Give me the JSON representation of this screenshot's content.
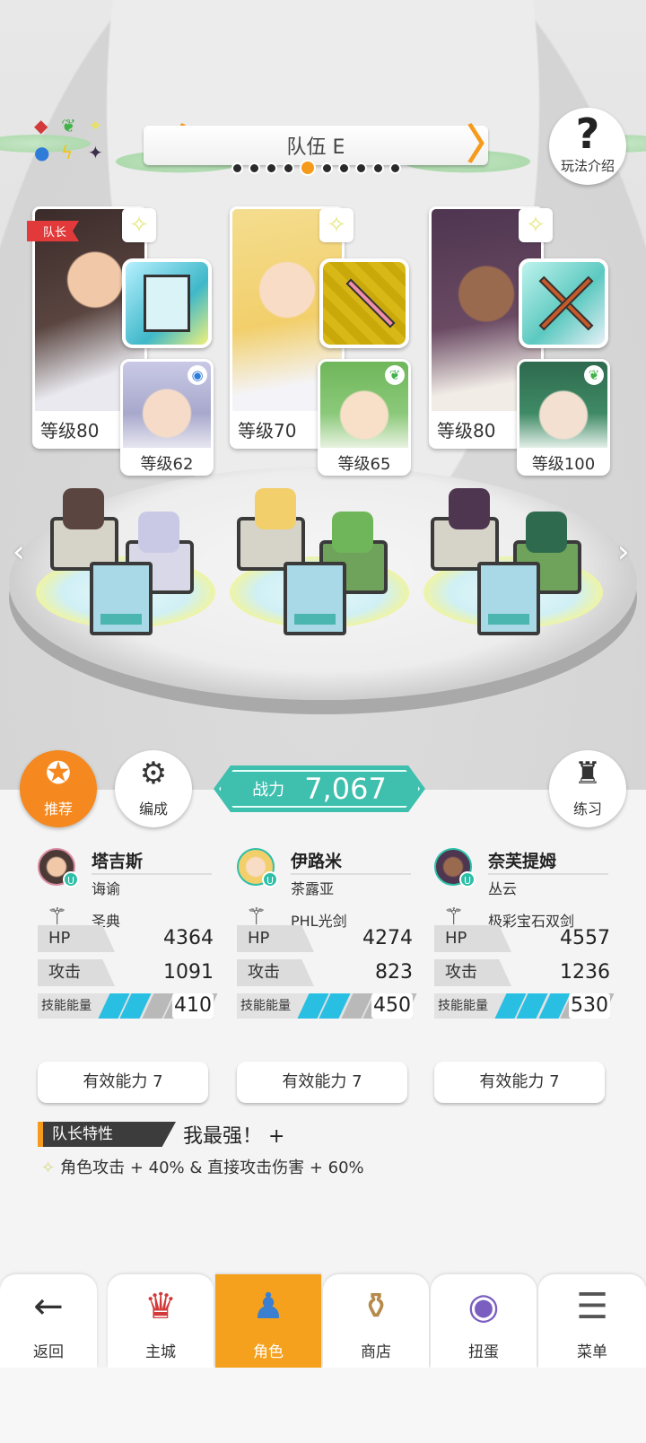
{
  "team": {
    "name": "队伍 E",
    "help_label": "玩法介绍",
    "page_count": 10,
    "active_page": 5
  },
  "characters": [
    {
      "leader_tag": "队长",
      "level": "等级80",
      "support_level": "等级62",
      "support_badge": "◉",
      "name": "塔吉斯",
      "subtitle": "诲谕",
      "weapon": "圣典",
      "hp_label": "HP",
      "hp": "4364",
      "atk_label": "攻击",
      "atk": "1091",
      "energy_label": "技能能量",
      "energy": "410",
      "energy_fill": 0.41,
      "ability": "有效能力 7",
      "portrait_color": "#4b3a36",
      "equip_color": "#3fb8c9"
    },
    {
      "leader_tag": "",
      "level": "等级70",
      "support_level": "等级65",
      "support_badge": "❦",
      "name": "伊路米",
      "subtitle": "茶露亚",
      "weapon": "PHL光剑",
      "hp_label": "HP",
      "hp": "4274",
      "atk_label": "攻击",
      "atk": "823",
      "energy_label": "技能能量",
      "energy": "450",
      "energy_fill": 0.45,
      "ability": "有效能力 7",
      "portrait_color": "#f1d58a",
      "equip_color": "#d8b817"
    },
    {
      "leader_tag": "",
      "level": "等级80",
      "support_level": "等级100",
      "support_badge": "❦",
      "name": "奈芙提姆",
      "subtitle": "丛云",
      "weapon": "极彩宝石双剑",
      "hp_label": "HP",
      "hp": "4557",
      "atk_label": "攻击",
      "atk": "1236",
      "energy_label": "技能能量",
      "energy": "530",
      "energy_fill": 0.53,
      "ability": "有效能力 7",
      "portrait_color": "#6a4a63",
      "equip_color": "#5cc9c0"
    }
  ],
  "actions": {
    "recommend": "推荐",
    "formation": "编成",
    "practice": "练习"
  },
  "power": {
    "label": "战力",
    "value": "7,067"
  },
  "leader_skill": {
    "tag": "队长特性",
    "name": "我最强！ +",
    "description": "角色攻击 + 40% & 直接攻击伤害 + 60%"
  },
  "nav": {
    "back": "返回",
    "castle": "主城",
    "characters": "角色",
    "shop": "商店",
    "gacha": "扭蛋",
    "menu": "菜单"
  },
  "colors": {
    "accent": "#f59a1b",
    "power": "#3fbfae",
    "energy_fill": "#29bfe3",
    "energy_empty": "#b9b9b9"
  }
}
